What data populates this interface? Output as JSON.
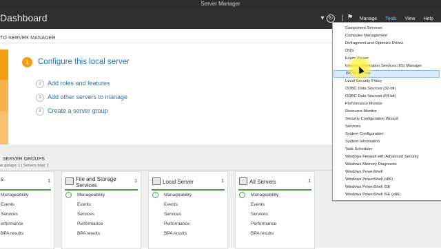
{
  "window": {
    "title": "Server Manager"
  },
  "header": {
    "title": "Dashboard",
    "nav": [
      "Manage",
      "Tools",
      "View",
      "Help"
    ]
  },
  "welcome": {
    "label": "TO SERVER MANAGER",
    "main_step": {
      "number": "1",
      "label": "Configure this local server"
    },
    "steps": [
      {
        "number": "2",
        "label": "Add roles and features"
      },
      {
        "number": "3",
        "label": "Add other servers to manage"
      },
      {
        "number": "4",
        "label": "Create a server group"
      }
    ]
  },
  "groups": {
    "title": "SERVER GROUPS",
    "subtitle": "er groups: 1  |  Servers total: 1",
    "tiles": [
      {
        "title": "s",
        "count": "1",
        "rows": [
          "Manageability",
          "Events",
          "Services",
          "erformance",
          "BPA results"
        ]
      },
      {
        "title": "File and Storage Services",
        "count": "1",
        "rows": [
          "Manageability",
          "Events",
          "Services",
          "Performance",
          "BPA results"
        ]
      },
      {
        "title": "Local Server",
        "count": "1",
        "rows": [
          "Manageability",
          "Events",
          "Services",
          "Performance",
          "BPA results"
        ]
      },
      {
        "title": "All Servers",
        "count": "1",
        "rows": [
          "Manageability",
          "Events",
          "Services",
          "Performance",
          "BPA results"
        ]
      }
    ]
  },
  "tools_menu": {
    "items": [
      "Component Services",
      "Computer Management",
      "Defragment and Optimize Drives",
      "DNS",
      "Event Viewer",
      "Internet Information Services (IIS) Manager",
      "iSCSI Initiator",
      "Local Security Policy",
      "ODBC Data Sources (32-bit)",
      "ODBC Data Sources (64-bit)",
      "Performance Monitor",
      "Resource Monitor",
      "Security Configuration Wizard",
      "Services",
      "System Configuration",
      "System Information",
      "Task Scheduler",
      "Windows Firewall with Advanced Security",
      "Windows Memory Diagnostic",
      "Windows PowerShell",
      "Windows PowerShell (x86)",
      "Windows PowerShell ISE",
      "Windows PowerShell ISE (x86)"
    ],
    "highlighted": "iSCSI Initiator"
  },
  "colors": {
    "accent_orange": "#f39c12",
    "link_blue": "#1e74b8",
    "ok_green": "#3fa33b",
    "header_bg": "#303030"
  }
}
